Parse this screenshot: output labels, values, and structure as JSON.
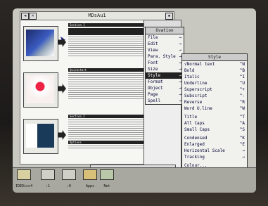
{
  "window": {
    "title": "MDsAu1"
  },
  "main_menu": {
    "title": "Ovation",
    "items": [
      {
        "label": "File",
        "arrow": "→"
      },
      {
        "label": "Edit",
        "arrow": "→"
      },
      {
        "label": "View",
        "arrow": "→"
      },
      {
        "label": "Para. Style",
        "arrow": "→"
      },
      {
        "label": "Font",
        "arrow": "→"
      },
      {
        "label": "Size",
        "arrow": "→"
      },
      {
        "label": "Style",
        "arrow": "→",
        "highlighted": true
      },
      {
        "label": "Format",
        "arrow": "→"
      },
      {
        "label": "Object",
        "arrow": "→"
      },
      {
        "label": "Page",
        "arrow": "→"
      },
      {
        "label": "Spell",
        "arrow": "→"
      }
    ]
  },
  "style_menu": {
    "title": "Style",
    "group1": [
      {
        "label": "√Normal text",
        "shortcut": "^N"
      },
      {
        "label": "Bold",
        "shortcut": "^B"
      },
      {
        "label": "Italic",
        "shortcut": "^I"
      },
      {
        "label": "Underline",
        "shortcut": "^U"
      },
      {
        "label": "Superscript",
        "shortcut": "^+"
      },
      {
        "label": "Subscript",
        "shortcut": "^-"
      },
      {
        "label": "Reverse",
        "shortcut": "^R"
      },
      {
        "label": "Word U.line",
        "shortcut": "^W"
      }
    ],
    "group2": [
      {
        "label": "Title",
        "shortcut": "^T"
      },
      {
        "label": "All Caps",
        "shortcut": "^A"
      },
      {
        "label": "Small Caps",
        "shortcut": "^S"
      }
    ],
    "group3": [
      {
        "label": "Condensed",
        "shortcut": "^K"
      },
      {
        "label": "Enlarged",
        "shortcut": "^E"
      },
      {
        "label": "Horizontal Scale",
        "shortcut": "→"
      },
      {
        "label": "Tracking",
        "shortcut": "→"
      }
    ],
    "group4": [
      {
        "label": "Colour...",
        "shortcut": ""
      }
    ]
  },
  "iconbar": {
    "items": [
      {
        "label": "IDEDisc4"
      },
      {
        "label": ":1"
      },
      {
        "label": ":0"
      },
      {
        "label": "Apps"
      },
      {
        "label": "Net"
      }
    ]
  },
  "document": {
    "headers": [
      "Section 1",
      "Quickstart",
      "Section 2",
      "Options"
    ]
  },
  "colors": {
    "menu_bg": "#f1f1ee",
    "highlight": "#222222",
    "screen_bg": "#c8c8c0"
  }
}
